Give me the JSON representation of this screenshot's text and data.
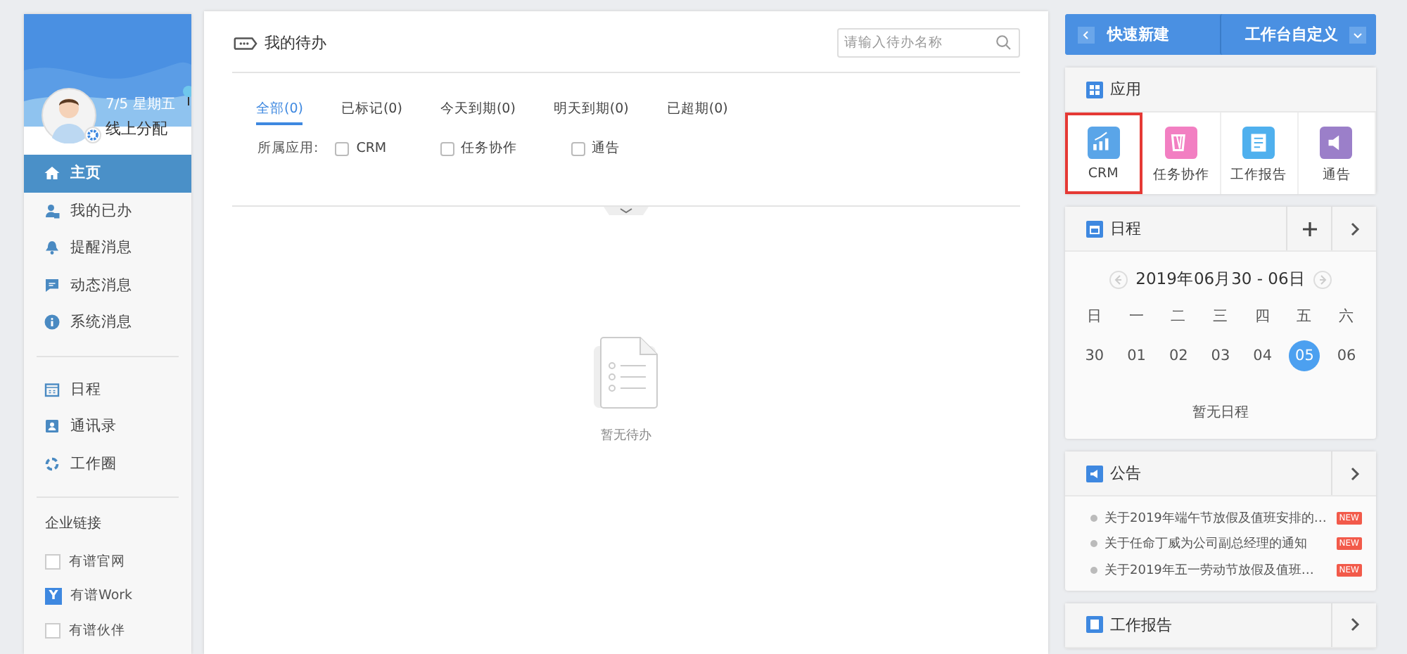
{
  "sidebar": {
    "date": "7/5 星期五",
    "user": "线上分配",
    "nav": [
      {
        "label": "主页",
        "selected": true
      },
      {
        "label": "我的已办",
        "selected": false
      },
      {
        "label": "提醒消息",
        "selected": false
      },
      {
        "label": "动态消息",
        "selected": false
      },
      {
        "label": "系统消息",
        "selected": false
      }
    ],
    "nav2": [
      {
        "label": "日程",
        "selected": false
      },
      {
        "label": "通讯录",
        "selected": false
      },
      {
        "label": "工作圈",
        "selected": false
      }
    ],
    "links_title": "企业链接",
    "links": [
      {
        "label": "有谱官网",
        "kind": "blank"
      },
      {
        "label": "有谱Work",
        "kind": "logo",
        "badge": "Y"
      },
      {
        "label": "有谱伙伴",
        "kind": "blank"
      }
    ]
  },
  "todo": {
    "title": "我的待办",
    "search": {
      "placeholder": "请输入待办名称"
    },
    "tabs": [
      {
        "label": "全部(0)",
        "selected": true
      },
      {
        "label": "已标记(0)",
        "selected": false
      },
      {
        "label": "今天到期(0)",
        "selected": false
      },
      {
        "label": "明天到期(0)",
        "selected": false
      },
      {
        "label": "已超期(0)",
        "selected": false
      }
    ],
    "filter_label": "所属应用:",
    "filters": [
      {
        "label": "CRM",
        "checked": false
      },
      {
        "label": "任务协作",
        "checked": false
      },
      {
        "label": "通告",
        "checked": false
      }
    ],
    "empty_text": "暂无待办"
  },
  "right": {
    "quick_new": "快速新建",
    "customize": "工作台自定义",
    "apps": {
      "title": "应用",
      "items": [
        {
          "label": "CRM",
          "highlighted": true,
          "color": "#5aa5e8"
        },
        {
          "label": "任务协作",
          "highlighted": false,
          "color": "#f27fc2"
        },
        {
          "label": "工作报告",
          "highlighted": false,
          "color": "#4fb0ee"
        },
        {
          "label": "通告",
          "highlighted": false,
          "color": "#9b7fc9"
        }
      ]
    },
    "schedule": {
      "title": "日程",
      "range": "2019年06月30 - 06日",
      "weekdays": [
        "日",
        "一",
        "二",
        "三",
        "四",
        "五",
        "六"
      ],
      "dates": [
        {
          "label": "30",
          "selected": false
        },
        {
          "label": "01",
          "selected": false
        },
        {
          "label": "02",
          "selected": false
        },
        {
          "label": "03",
          "selected": false
        },
        {
          "label": "04",
          "selected": false
        },
        {
          "label": "05",
          "selected": true
        },
        {
          "label": "06",
          "selected": false
        }
      ],
      "empty_text": "暂无日程"
    },
    "notices": {
      "title": "公告",
      "items": [
        {
          "text": "关于2019年端午节放假及值班安排的…",
          "badge": "NEW"
        },
        {
          "text": "关于任命丁威为公司副总经理的通知",
          "badge": "NEW"
        },
        {
          "text": "关于2019年五一劳动节放假及值班…",
          "badge": "NEW"
        }
      ]
    },
    "report": {
      "title": "工作报告"
    }
  }
}
